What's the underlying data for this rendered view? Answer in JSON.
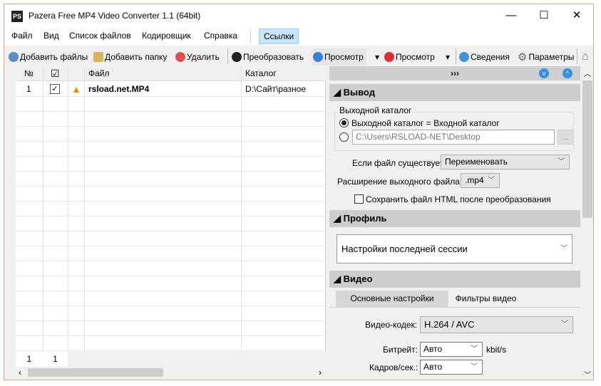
{
  "window": {
    "title": "Pazera Free MP4 Video Converter 1.1 (64bit)",
    "logo": "PS",
    "minimize": "—",
    "maximize": "☐",
    "close": "✕"
  },
  "menu": [
    "Файл",
    "Вид",
    "Список файлов",
    "Кодировщик",
    "Справка",
    "Ссылки"
  ],
  "toolbar": {
    "add_files": "Добавить файлы",
    "add_folder": "Добавить папку",
    "delete": "Удалить",
    "convert": "Преобразовать",
    "preview1": "Просмотр",
    "preview2": "Просмотр",
    "info": "Сведения",
    "settings": "Параметры"
  },
  "grid": {
    "headers": [
      "№",
      "☑",
      "",
      "Файл",
      "Каталог"
    ],
    "rows": [
      {
        "num": "1",
        "checked": true,
        "file": "rsload.net.MP4",
        "dir": "D:\\Сайт\\разное"
      }
    ],
    "footer": [
      "1",
      "1"
    ]
  },
  "right": {
    "expand": "›››",
    "output": {
      "title": "Вывод",
      "group": "Выходной каталог",
      "radio1": "Выходной каталог = Входной каталог",
      "radio2_path": "C:\\Users\\RSLOAD-NET\\Desktop",
      "browse": "...",
      "exists_label": "Если файл существует:",
      "exists_value": "Переименовать",
      "ext_label": "Расширение выходного файла:",
      "ext_value": ".mp4",
      "save_html": "Сохранить файл HTML после преобразования"
    },
    "profile": {
      "title": "Профиль",
      "value": "Настройки последней сессии"
    },
    "video": {
      "title": "Видео",
      "tabs": [
        "Основные настройки",
        "Фильтры видео"
      ],
      "codec_label": "Видео-кодек:",
      "codec_value": "H.264 / AVC",
      "bitrate_label": "Битрейт:",
      "bitrate_value": "Авто",
      "bitrate_unit": "kbit/s",
      "fps_label": "Кадров/сек.:",
      "fps_value": "Авто"
    }
  },
  "colors": {
    "accent": "#3a7fd5",
    "menu_selected": "#cce4f7",
    "section": "#cdcdcd",
    "border": "#d8a88a"
  }
}
